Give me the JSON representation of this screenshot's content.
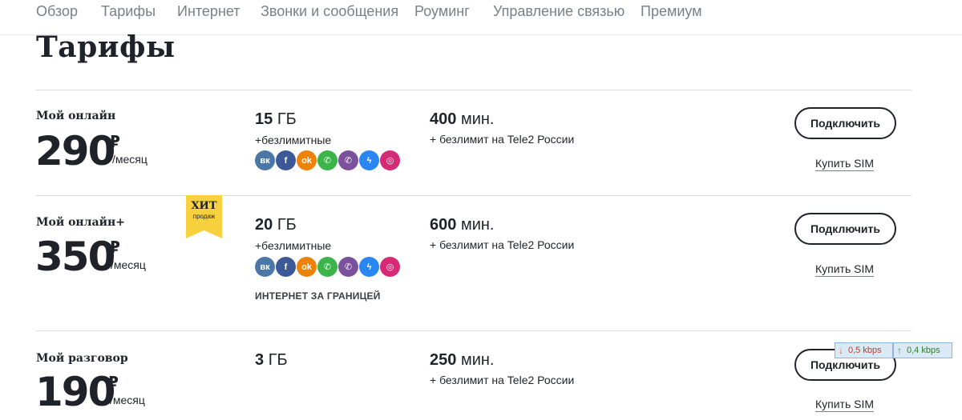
{
  "nav": {
    "items": [
      "Обзор",
      "Тарифы",
      "Интернет",
      "Звонки и сообщения",
      "Роуминг",
      "Управление связью",
      "Премиум"
    ]
  },
  "page_title": "Тарифы",
  "currency": "₽",
  "period_label": "/месяц",
  "unlimited_label": "+безлимитные",
  "connect_label": "Подключить",
  "buy_sim_label": "Купить SIM",
  "social_icons": [
    {
      "name": "vk-icon",
      "glyph": "вк",
      "color": "#4a76a8"
    },
    {
      "name": "facebook-icon",
      "glyph": "f",
      "color": "#3b5998"
    },
    {
      "name": "odnoklassniki-icon",
      "glyph": "ok",
      "color": "#ee8208"
    },
    {
      "name": "whatsapp-icon",
      "glyph": "✆",
      "color": "#3bb54a"
    },
    {
      "name": "viber-icon",
      "glyph": "✆",
      "color": "#7b519d"
    },
    {
      "name": "messenger-icon",
      "glyph": "ϟ",
      "color": "#2a86f3"
    },
    {
      "name": "instagram-icon",
      "glyph": "◎",
      "color": "#d62976"
    }
  ],
  "tariffs": [
    {
      "name": "Мой онлайн",
      "price": "290",
      "gb": "15",
      "gb_unit": "ГБ",
      "minutes": "400",
      "minutes_unit": "мин.",
      "minutes_sub": "+ безлимит на Tele2 России",
      "has_unlimited": true
    },
    {
      "name": "Мой онлайн+",
      "price": "350",
      "gb": "20",
      "gb_unit": "ГБ",
      "minutes": "600",
      "minutes_unit": "мин.",
      "minutes_sub": "+ безлимит на Tele2 России",
      "has_unlimited": true,
      "badge": {
        "title": "ХИТ",
        "subtitle": "продаж",
        "color": "#f7d23e"
      },
      "extra": "ИНТЕРНЕТ ЗА ГРАНИЦЕЙ"
    },
    {
      "name": "Мой разговор",
      "price": "190",
      "gb": "3",
      "gb_unit": "ГБ",
      "minutes": "250",
      "minutes_unit": "мин.",
      "minutes_sub": "+ безлимит на Tele2 России",
      "has_unlimited": false
    }
  ],
  "speed_widget": {
    "down": "0,5 kbps",
    "up": "0,4 kbps",
    "down_color": "#e36a3a",
    "up_color": "#3aa63a"
  }
}
